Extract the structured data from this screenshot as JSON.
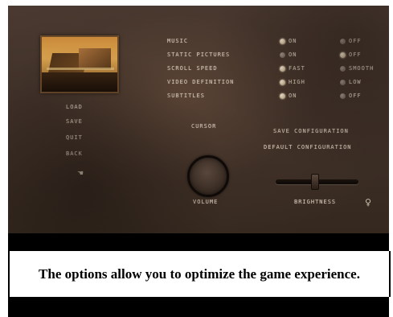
{
  "game": {
    "left_menu": [
      "LOAD",
      "SAVE",
      "QUIT",
      "BACK"
    ],
    "options": [
      {
        "label": "MUSIC",
        "choice_a": "ON",
        "choice_b": "OFF",
        "selected": "a"
      },
      {
        "label": "STATIC PICTURES",
        "choice_a": "ON",
        "choice_b": "OFF",
        "selected": "b"
      },
      {
        "label": "SCROLL SPEED",
        "choice_a": "FAST",
        "choice_b": "SMOOTH",
        "selected": "a"
      },
      {
        "label": "VIDEO DEFINITION",
        "choice_a": "HIGH",
        "choice_b": "LOW",
        "selected": "a"
      },
      {
        "label": "SUBTITLES",
        "choice_a": "ON",
        "choice_b": "OFF",
        "selected": "a"
      }
    ],
    "cursor_label": "CURSOR",
    "volume_label": "VOLUME",
    "brightness_label": "BRIGHTNESS",
    "configuration": {
      "save": "SAVE CONFIGURATION",
      "default": "DEFAULT CONFIGURATION"
    },
    "brightness_level": 0.47,
    "icons": {
      "cursor": "hand-pointer-icon",
      "corner": "figure-icon"
    }
  },
  "caption": {
    "text": "The options allow you to optimize the game experience."
  },
  "colors": {
    "background": "#3f3129",
    "etched_text": "#cfc2b2",
    "caption_bar": "#000000"
  }
}
